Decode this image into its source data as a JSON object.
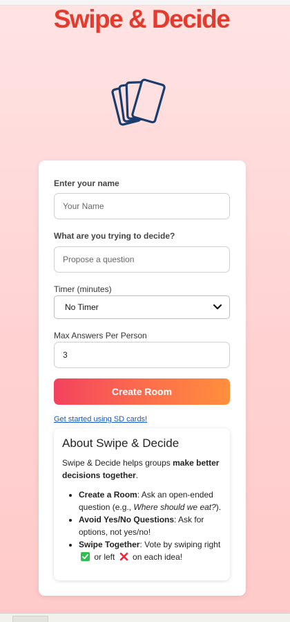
{
  "app": {
    "logo_text": "Swipe & Decide",
    "accent": "#e43b2f"
  },
  "form": {
    "name_label": "Enter your name",
    "name_placeholder": "Your Name",
    "question_label": "What are you trying to decide?",
    "question_placeholder": "Propose a question",
    "timer_label": "Timer (minutes)",
    "timer_value": "No Timer",
    "max_label": "Max Answers Per Person",
    "max_value": "3",
    "create_button": "Create Room",
    "guide_link": "Get started using SD cards!"
  },
  "about": {
    "title": "About Swipe & Decide",
    "intro_prefix": "Swipe & Decide helps groups ",
    "intro_bold": "make better decisions together",
    "intro_suffix": ".",
    "items": [
      {
        "bold": "Create a Room",
        "text": ": Ask an open-ended question (e.g., ",
        "italic": "Where should we eat?",
        "after": ")."
      },
      {
        "bold": "Avoid Yes/No Questions",
        "text": ": Ask for options, not yes/no!"
      },
      {
        "bold": "Swipe Together",
        "text": ": Vote by swiping right",
        "mid": " or left",
        "end": " on each idea!"
      }
    ]
  },
  "icons": [
    "cards-icon",
    "chevron-down-icon",
    "check-mark-icon",
    "cross-mark-icon"
  ]
}
